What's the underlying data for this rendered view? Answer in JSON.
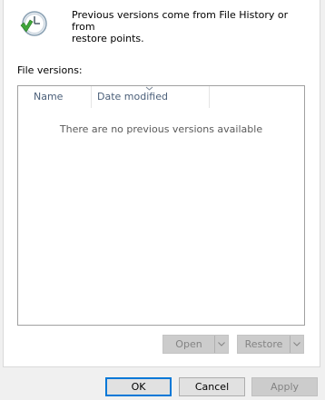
{
  "info": {
    "line1": "Previous versions come from File History or from",
    "line2": "restore points."
  },
  "file_versions": {
    "label": "File versions:",
    "columns": [
      "Name",
      "Date modified"
    ],
    "empty_message": "There are no previous versions available"
  },
  "actions": {
    "open_label": "Open",
    "restore_label": "Restore"
  },
  "dialog_buttons": {
    "ok": "OK",
    "cancel": "Cancel",
    "apply": "Apply"
  },
  "colors": {
    "accent": "#0078d7",
    "header_text": "#4c607a",
    "disabled_text": "#838383"
  }
}
